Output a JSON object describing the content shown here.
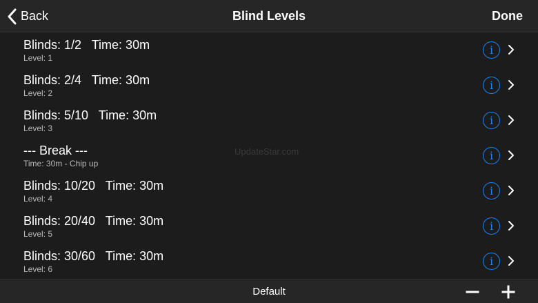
{
  "nav": {
    "back_label": "Back",
    "title": "Blind Levels",
    "done_label": "Done"
  },
  "levels": [
    {
      "title": "Blinds: 1/2   Time: 30m",
      "subtitle": "Level: 1"
    },
    {
      "title": "Blinds: 2/4   Time: 30m",
      "subtitle": "Level: 2"
    },
    {
      "title": "Blinds: 5/10   Time: 30m",
      "subtitle": "Level: 3"
    },
    {
      "title": "--- Break ---",
      "subtitle": "Time: 30m - Chip up"
    },
    {
      "title": "Blinds: 10/20   Time: 30m",
      "subtitle": "Level: 4"
    },
    {
      "title": "Blinds: 20/40   Time: 30m",
      "subtitle": "Level: 5"
    },
    {
      "title": "Blinds: 30/60   Time: 30m",
      "subtitle": "Level: 6"
    }
  ],
  "icons": {
    "back": "chevron-left-icon",
    "info": "info-icon",
    "disclosure": "chevron-right-icon",
    "remove": "minus-icon",
    "add": "plus-icon"
  },
  "info_glyph": "i",
  "watermark": "UpdateStar.com",
  "toolbar": {
    "center_label": "Default"
  },
  "colors": {
    "background": "#1c1c1c",
    "bar": "#262626",
    "accent": "#1a82f7",
    "text": "#ffffff",
    "subtext": "#b9b9b9"
  }
}
